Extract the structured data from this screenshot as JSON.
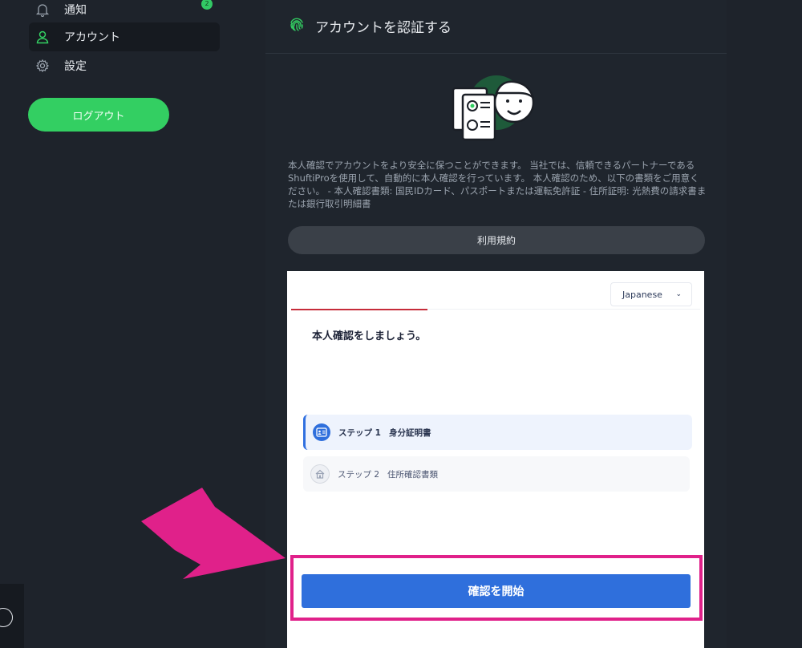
{
  "sidebar": {
    "items": [
      {
        "label": "通知",
        "icon": "bell-icon",
        "badge": "2"
      },
      {
        "label": "アカウント",
        "icon": "user-icon"
      },
      {
        "label": "設定",
        "icon": "gear-icon"
      }
    ],
    "logout_label": "ログアウト"
  },
  "panel": {
    "title": "アカウントを認証する",
    "description": "本人確認でアカウントをより安全に保つことができます。 当社では、信頼できるパートナーであるShuftiProを使用して、自動的に本人確認を行っています。 本人確認のため、以下の書類をご用意ください。 - 本人確認書類: 国民IDカード、パスポートまたは運転免許証 - 住所証明: 光熱費の請求書または銀行取引明細書",
    "terms_label": "利用規約"
  },
  "verification": {
    "language": "Japanese",
    "heading": "本人確認をしましょう。",
    "steps": [
      {
        "number": "ステップ 1",
        "name": "身分証明書"
      },
      {
        "number": "ステップ 2",
        "name": "住所確認書類"
      }
    ],
    "start_label": "確認を開始"
  },
  "colors": {
    "accent_green": "#33cf62",
    "primary_blue": "#2f6fdc",
    "highlight_pink": "#e0218a",
    "progress_red": "#c62c3a"
  }
}
